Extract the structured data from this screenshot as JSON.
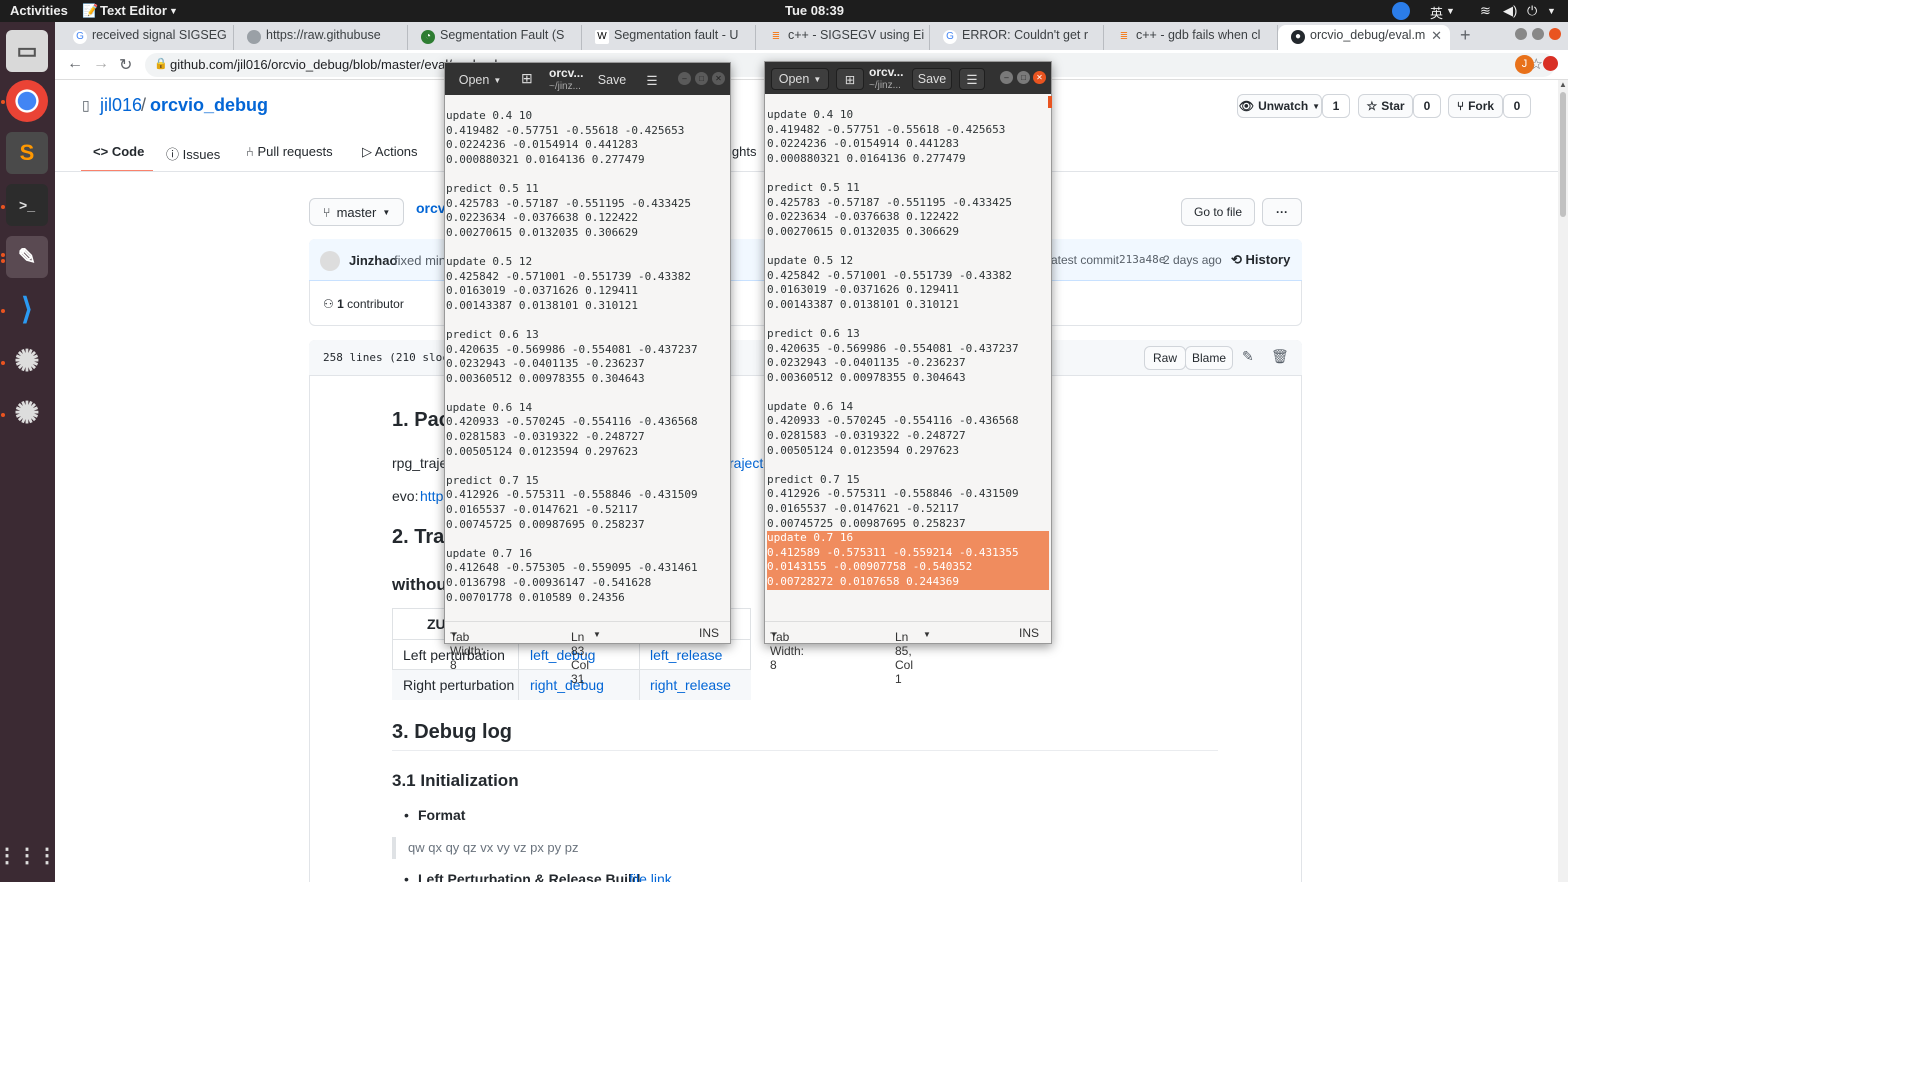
{
  "topbar": {
    "activities": "Activities",
    "app": "Text Editor",
    "clock": "Tue 08:39",
    "lang": "英"
  },
  "dock": {
    "apps": [
      "files-icon",
      "chrome-icon",
      "sublime-icon",
      "terminal-icon",
      "text-editor-icon",
      "vscode-icon",
      "ros-icon",
      "ros-icon-2",
      "app-grid-icon"
    ]
  },
  "browser": {
    "tabs": [
      {
        "title": "received signal SIGSEG"
      },
      {
        "title": "https://raw.githubuse"
      },
      {
        "title": "Segmentation Fault (S"
      },
      {
        "title": "Segmentation fault - U"
      },
      {
        "title": "c++ - SIGSEGV using Ei"
      },
      {
        "title": "ERROR: Couldn't get r"
      },
      {
        "title": "c++ - gdb fails when cl"
      },
      {
        "title": "orcvio_debug/eval.m"
      }
    ],
    "url": "github.com/jil016/orcvio_debug/blob/master/eval/eval.md",
    "profile_initial": "J"
  },
  "github": {
    "owner": "jil016",
    "repo": "orcvio_debug",
    "unwatch": "Unwatch",
    "watch_count": "1",
    "star": "Star",
    "star_count": "0",
    "fork": "Fork",
    "fork_count": "0",
    "nav": [
      "Code",
      "Issues",
      "Pull requests",
      "Actions",
      "ights"
    ],
    "branch": "master",
    "path_head": "orcv",
    "go_to_file": "Go to file",
    "commit_author": "Jinzhao",
    "commit_msg": "fixed minor",
    "commit_info_prefix": "atest commit",
    "commit_hash": "213a48e",
    "commit_age": "2 days ago",
    "history": "History",
    "contributors_count": "1",
    "contributors_label": "contributor",
    "file_stats": "258 lines (210 sloc)",
    "raw": "Raw",
    "blame": "Blame",
    "h1": "1. Pac",
    "rpg_text": "rpg_traje",
    "rpg_link": "rajecto",
    "evo_label": "evo:",
    "evo_link": "https",
    "h2": "2. Tra",
    "h3_without": "withou",
    "table_head": "ZU",
    "table": [
      {
        "label": "Left perturbation",
        "debug": "left_debug",
        "release": "left_release"
      },
      {
        "label": "Right perturbation",
        "debug": "right_debug",
        "release": "right_release"
      }
    ],
    "h_debug": "3. Debug log",
    "h_init": "3.1 Initialization",
    "format_label": "Format",
    "format_quote": "qw qx qy qz vx vy vz px py pz",
    "left_build": "Left Perturbation & Release Build",
    "file_link": "file link"
  },
  "editor1": {
    "open": "Open",
    "title": "orcv...",
    "subtitle": "~/jinz...",
    "save": "Save",
    "lines": "update 0.4 10\n0.419482 -0.57751 -0.55618 -0.425653\n0.0224236 -0.0154914 0.441283\n0.000880321 0.0164136 0.277479\n\npredict 0.5 11\n0.425783 -0.57187 -0.551195 -0.433425\n0.0223634 -0.0376638 0.122422\n0.00270615 0.0132035 0.306629\n\nupdate 0.5 12\n0.425842 -0.571001 -0.551739 -0.43382\n0.0163019 -0.0371626 0.129411\n0.00143387 0.0138101 0.310121\n\npredict 0.6 13\n0.420635 -0.569986 -0.554081 -0.437237\n0.0232943 -0.0401135 -0.236237\n0.00360512 0.00978355 0.304643\n\nupdate 0.6 14\n0.420933 -0.570245 -0.554116 -0.436568\n0.0281583 -0.0319322 -0.248727\n0.00505124 0.0123594 0.297623\n\npredict 0.7 15\n0.412926 -0.575311 -0.558846 -0.431509\n0.0165537 -0.0147621 -0.52117\n0.00745725 0.00987695 0.258237\n\nupdate 0.7 16\n0.412648 -0.575305 -0.559095 -0.431461\n0.0136798 -0.00936147 -0.541628\n0.00701778 0.010589 0.24356",
    "tab_width": "Tab Width: 8",
    "position": "Ln 83, Col 31",
    "mode": "INS"
  },
  "editor2": {
    "open": "Open",
    "title": "orcv...",
    "subtitle": "~/jinz...",
    "save": "Save",
    "lines": "update 0.4 10\n0.419482 -0.57751 -0.55618 -0.425653\n0.0224236 -0.0154914 0.441283\n0.000880321 0.0164136 0.277479\n\npredict 0.5 11\n0.425783 -0.57187 -0.551195 -0.433425\n0.0223634 -0.0376638 0.122422\n0.00270615 0.0132035 0.306629\n\nupdate 0.5 12\n0.425842 -0.571001 -0.551739 -0.43382\n0.0163019 -0.0371626 0.129411\n0.00143387 0.0138101 0.310121\n\npredict 0.6 13\n0.420635 -0.569986 -0.554081 -0.437237\n0.0232943 -0.0401135 -0.236237\n0.00360512 0.00978355 0.304643\n\nupdate 0.6 14\n0.420933 -0.570245 -0.554116 -0.436568\n0.0281583 -0.0319322 -0.248727\n0.00505124 0.0123594 0.297623\n\npredict 0.7 15\n0.412926 -0.575311 -0.558846 -0.431509\n0.0165537 -0.0147621 -0.52117\n0.00745725 0.00987695 0.258237\n",
    "selected": "update 0.7 16\n0.412589 -0.575311 -0.559214 -0.431355\n0.0143155 -0.00907758 -0.540352\n0.00728272 0.0107658 0.244369",
    "tab_width": "Tab Width: 8",
    "position": "Ln 85, Col 1",
    "mode": "INS"
  },
  "colors": {
    "accent": "#e95420",
    "selection": "#f08c5e",
    "link": "#0366d6"
  }
}
